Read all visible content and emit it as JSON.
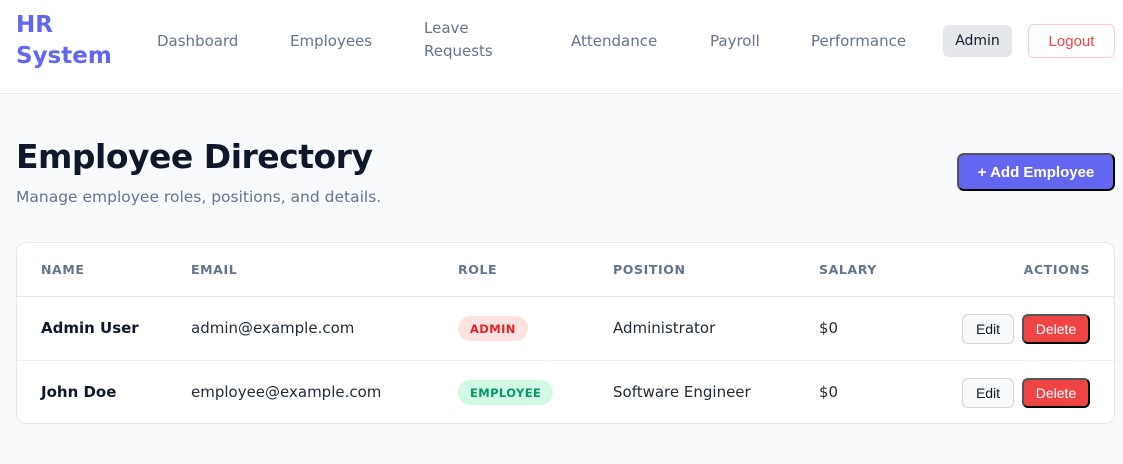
{
  "brand": {
    "title": "HR System"
  },
  "nav": {
    "items": [
      {
        "label": "Dashboard"
      },
      {
        "label": "Employees"
      },
      {
        "label": "Leave Requests"
      },
      {
        "label": "Attendance"
      },
      {
        "label": "Payroll"
      },
      {
        "label": "Performance"
      }
    ],
    "user_role": "Admin",
    "logout_label": "Logout"
  },
  "page": {
    "title": "Employee Directory",
    "subtitle": "Manage employee roles, positions, and details.",
    "add_button_label": "+ Add Employee"
  },
  "table": {
    "columns": [
      "NAME",
      "EMAIL",
      "ROLE",
      "POSITION",
      "SALARY",
      "ACTIONS"
    ],
    "rows": [
      {
        "name": "Admin User",
        "email": "admin@example.com",
        "role": "ADMIN",
        "position": "Administrator",
        "salary": "$0",
        "edit": "Edit",
        "delete": "Delete"
      },
      {
        "name": "John Doe",
        "email": "employee@example.com",
        "role": "EMPLOYEE",
        "position": "Software Engineer",
        "salary": "$0",
        "edit": "Edit",
        "delete": "Delete"
      }
    ]
  },
  "colors": {
    "accent": "#6366f1",
    "danger": "#ef4444",
    "admin_badge_bg": "#fee2e2",
    "employee_badge_bg": "#d1fae5"
  }
}
